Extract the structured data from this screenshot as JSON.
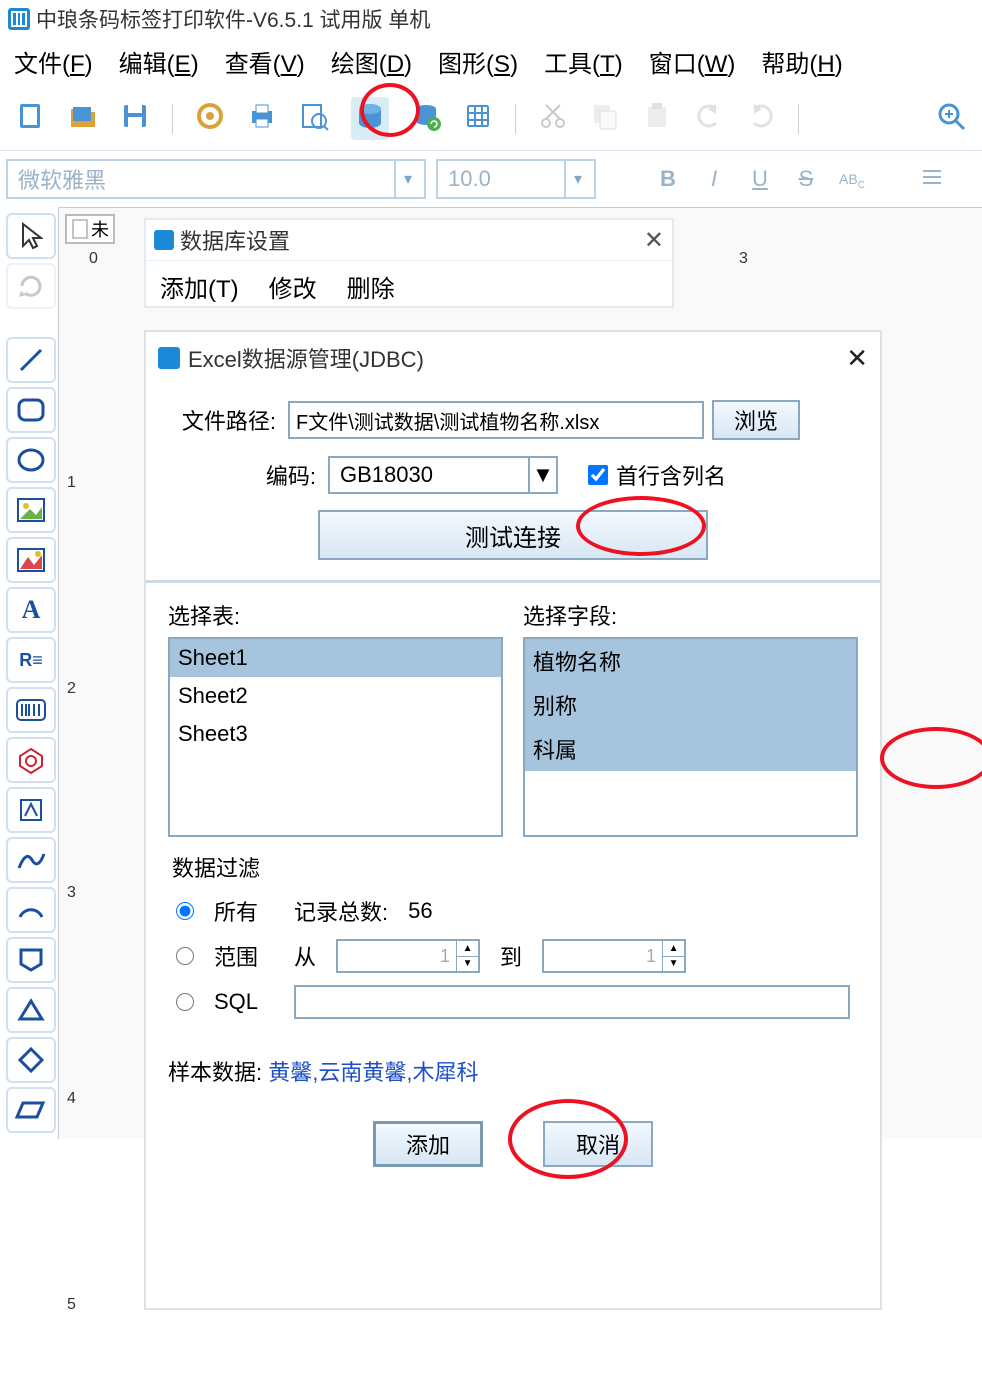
{
  "app": {
    "title": "中琅条码标签打印软件-V6.5.1 试用版 单机"
  },
  "menu": {
    "file": "文件(<u>F</u>)",
    "edit": "编辑(<u>E</u>)",
    "view": "查看(<u>V</u>)",
    "draw": "绘图(<u>D</u>)",
    "shape": "图形(<u>S</u>)",
    "tool": "工具(<u>T</u>)",
    "window": "窗口(<u>W</u>)",
    "help": "帮助(<u>H</u>)"
  },
  "font": {
    "name": "微软雅黑",
    "size": "10.0"
  },
  "paper_tab": "未",
  "ruler_h": {
    "m0": "0",
    "m3": "3"
  },
  "ruler_v": {
    "m1": "1",
    "m2": "2",
    "m3": "3",
    "m4": "4",
    "m5": "5"
  },
  "dlg1": {
    "title": "数据库设置",
    "add": "添加(T)",
    "modify": "修改",
    "delete": "删除"
  },
  "dlg2": {
    "title": "Excel数据源管理(JDBC)",
    "file_path_label": "文件路径:",
    "file_path": "F文件\\测试数据\\测试植物名称.xlsx",
    "browse": "浏览",
    "encoding_label": "编码:",
    "encoding": "GB18030",
    "first_row_label": "首行含列名",
    "test_conn": "测试连接",
    "select_table": "选择表:",
    "tables": [
      "Sheet1",
      "Sheet2",
      "Sheet3"
    ],
    "select_field": "选择字段:",
    "fields": [
      "植物名称",
      "别称",
      "科属"
    ],
    "filter": {
      "title": "数据过滤",
      "all": "所有",
      "total_label": "记录总数:",
      "total": "56",
      "range": "范围",
      "from": "从",
      "from_val": "1",
      "to": "到",
      "to_val": "1",
      "sql": "SQL"
    },
    "sample_label": "样本数据:",
    "sample_data": "黄馨,云南黄馨,木犀科",
    "add": "添加",
    "cancel": "取消"
  }
}
